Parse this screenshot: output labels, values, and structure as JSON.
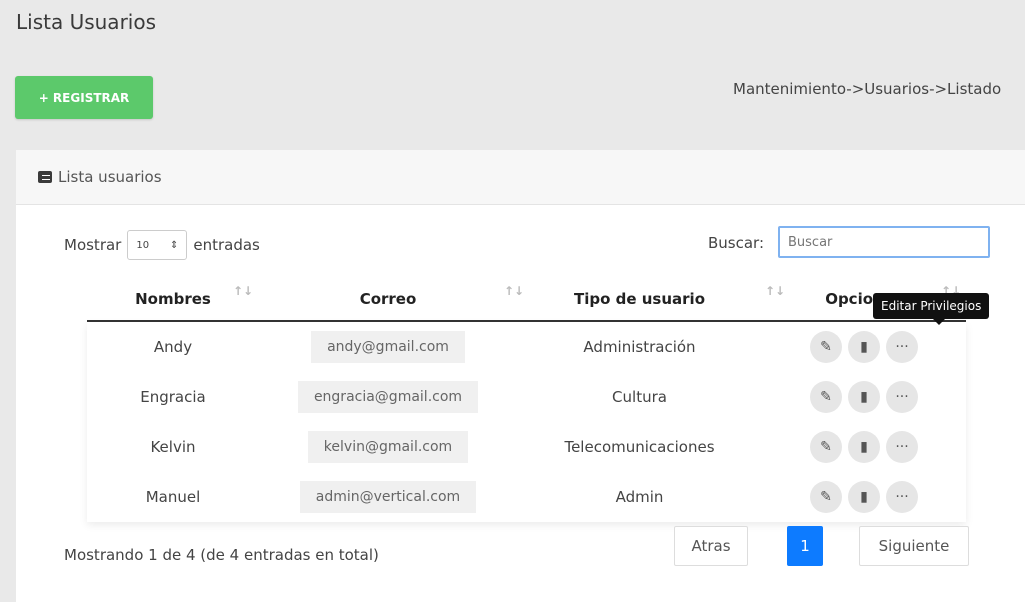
{
  "page": {
    "title": "Lista Usuarios"
  },
  "toolbar": {
    "register_label": "+ REGISTRAR"
  },
  "breadcrumb": "Mantenimiento->Usuarios->Listado",
  "card": {
    "header": "Lista usuarios"
  },
  "filters": {
    "show_label": "Mostrar",
    "entries_value": "10",
    "entries_label": "entradas",
    "search_label": "Buscar:",
    "search_placeholder": "Buscar"
  },
  "table": {
    "headers": [
      "Nombres",
      "Correo",
      "Tipo de usuario",
      "Opciones"
    ],
    "rows": [
      {
        "name": "Andy",
        "email": "andy@gmail.com",
        "type": "Administración"
      },
      {
        "name": "Engracia",
        "email": "engracia@gmail.com",
        "type": "Cultura"
      },
      {
        "name": "Kelvin",
        "email": "kelvin@gmail.com",
        "type": "Telecomunicaciones"
      },
      {
        "name": "Manuel",
        "email": "admin@vertical.com",
        "type": "Admin"
      }
    ]
  },
  "tooltip": "Editar Privilegios",
  "footer": {
    "info": "Mostrando 1 de 4 (de 4 entradas en total)",
    "prev_label": "Atras",
    "current_page": "1",
    "next_label": "Siguiente"
  },
  "colors": {
    "register": "#5cc96b",
    "active_page": "#0d7bff",
    "search_border": "#7fb2f0"
  }
}
